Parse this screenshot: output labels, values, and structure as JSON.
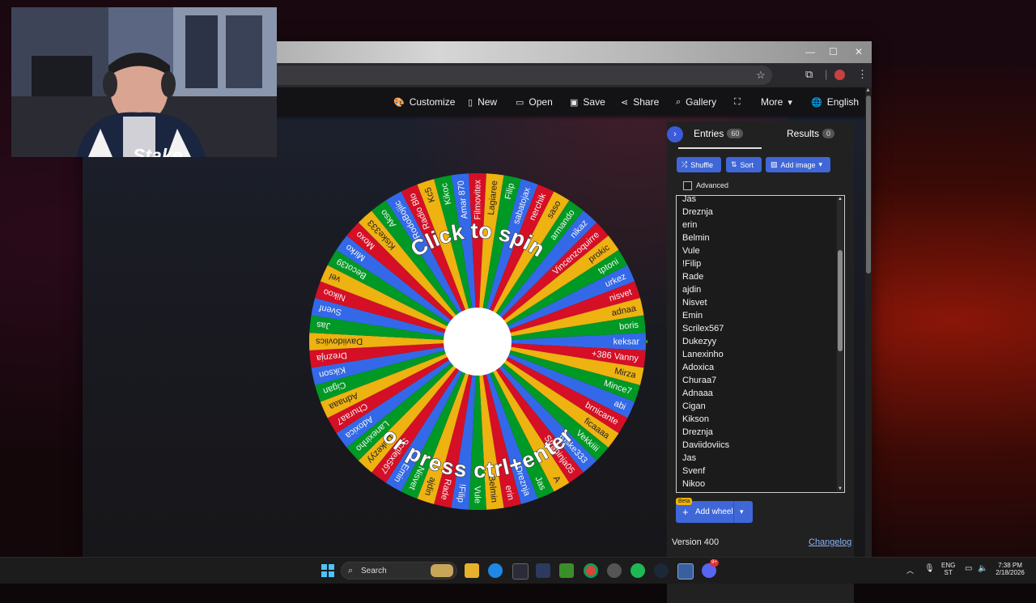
{
  "browser": {
    "window_controls": {
      "minimize": "—",
      "maximize": "☐",
      "close": "✕"
    }
  },
  "nav": {
    "customize": "Customize",
    "new": "New",
    "open": "Open",
    "save": "Save",
    "share": "Share",
    "gallery": "Gallery",
    "more": "More",
    "language": "English"
  },
  "wheel": {
    "top_text": "Click to spin",
    "bottom_text": "or press ctrl+enter",
    "segment_colors": [
      "#3369e8",
      "#d50f25",
      "#eeb211",
      "#009925"
    ],
    "labels": [
      "keksar",
      "+386 Vanny",
      "Mirza",
      "Mince7",
      "abi",
      "brnicante",
      "ficaaaa",
      "Vekkiiii",
      "Kiske333",
      "Strahinja05",
      "A",
      "Jas",
      "Dreznja",
      "erin",
      "Belmin",
      "Vule",
      "!Filip",
      "Rade",
      "ajdin",
      "Nisvet",
      "Emin",
      "Scrilex567",
      "Dukezyy",
      "Lanexinho",
      "Adoxica",
      "Churaa7",
      "Adnaaa",
      "Cigan",
      "Kikson",
      "Dreznja",
      "Daviidoviics",
      "Jas",
      "Svenf",
      "Nikoo",
      "vel",
      "Becot39",
      "Mirko",
      "Moxo",
      "Kiske333",
      "Akso",
      "RodoBojiic",
      "Radio Blo",
      "Kc5",
      "Kikoc",
      "Amar 870",
      "Filmovitex",
      "Lagiaree",
      "Filip",
      "sabatojax",
      "nerchik",
      "saso",
      "armando",
      "nikaz",
      "Vincenzoquirre",
      "prokic",
      "tptoni",
      "urkez",
      "nisvet",
      "adnaa",
      "boris"
    ]
  },
  "sidebar": {
    "entries_tab": "Entries",
    "entries_count": "60",
    "results_tab": "Results",
    "results_count": "0",
    "shuffle": "Shuffle",
    "sort": "Sort",
    "add_image": "Add image",
    "advanced": "Advanced",
    "entries": [
      "Jas",
      "Dreznja",
      "erin",
      "Belmin",
      "Vule",
      "!Filip",
      "Rade",
      "ajdin",
      "Nisvet",
      "Emin",
      "Scrilex567",
      "Dukezyy",
      "Lanexinho",
      "Adoxica",
      "Churaa7",
      "Adnaaa",
      "Cigan",
      "Kikson",
      "Dreznja",
      "Daviidoviics",
      "Jas",
      "Svenf",
      "Nikoo"
    ],
    "beta": "Beta",
    "add_wheel": "Add wheel",
    "version": "Version 400",
    "changelog": "Changelog"
  },
  "webcam": {
    "logo": "Stake"
  },
  "taskbar": {
    "search": "Search",
    "lang_top": "ENG",
    "lang_bottom": "ST",
    "time": "7:38 PM",
    "date": "2/18/2026",
    "discord_badge": "9+"
  }
}
